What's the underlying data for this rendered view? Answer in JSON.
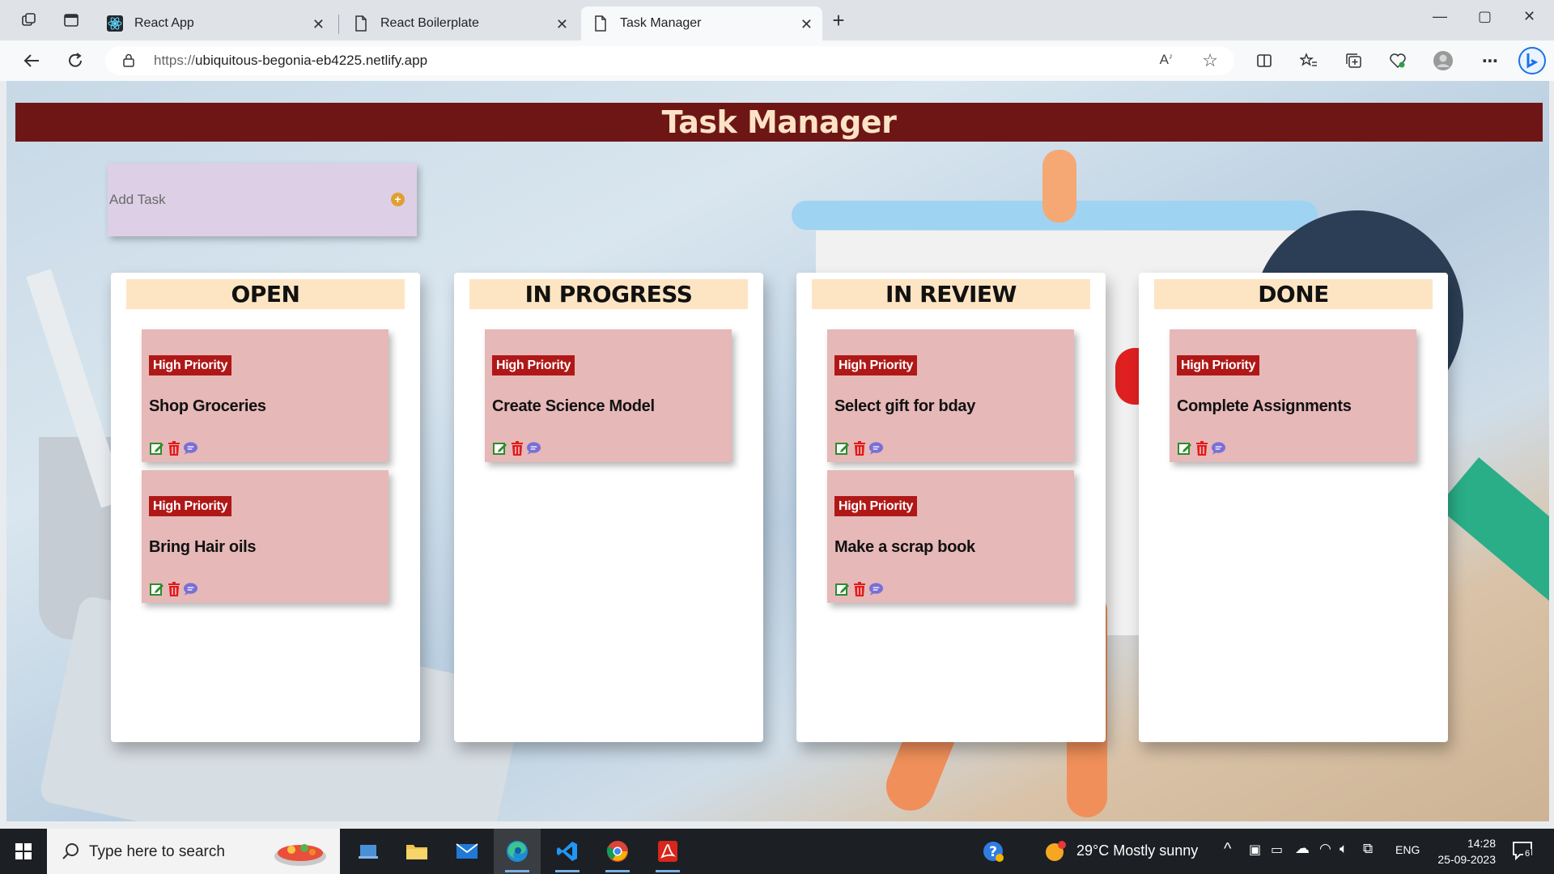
{
  "browser": {
    "tabs": [
      {
        "title": "React App",
        "favicon": "react-icon",
        "active": false
      },
      {
        "title": "React Boilerplate",
        "favicon": "page-icon",
        "active": false
      },
      {
        "title": "Task Manager",
        "favicon": "page-icon",
        "active": true
      }
    ],
    "url_protocol": "https://",
    "url_host": "ubiquitous-begonia-eb4225.netlify.app"
  },
  "app": {
    "title": "Task Manager",
    "add_task_placeholder": "Add Task",
    "add_task_button_symbol": "+",
    "columns": [
      {
        "title": "OPEN",
        "cards": [
          {
            "priority": "High Priority",
            "title": "Shop Groceries"
          },
          {
            "priority": "High Priority",
            "title": "Bring Hair oils"
          }
        ]
      },
      {
        "title": "IN PROGRESS",
        "cards": [
          {
            "priority": "High Priority",
            "title": "Create Science Model"
          }
        ]
      },
      {
        "title": "IN REVIEW",
        "cards": [
          {
            "priority": "High Priority",
            "title": "Select gift for bday"
          },
          {
            "priority": "High Priority",
            "title": "Make a scrap book"
          }
        ]
      },
      {
        "title": "DONE",
        "cards": [
          {
            "priority": "High Priority",
            "title": "Complete Assignments"
          }
        ]
      }
    ]
  },
  "taskbar": {
    "search_placeholder": "Type here to search",
    "weather": "29°C  Mostly sunny",
    "language": "ENG",
    "time": "14:28",
    "date": "25-09-2023",
    "notification_count": "6"
  },
  "colors": {
    "header_bg": "#6e1616",
    "header_text": "#fde3c6",
    "column_title_bg": "#fde5c4",
    "card_bg": "#e6b8b8",
    "badge_bg": "#b01818",
    "add_task_bg": "#ddd0e6"
  }
}
